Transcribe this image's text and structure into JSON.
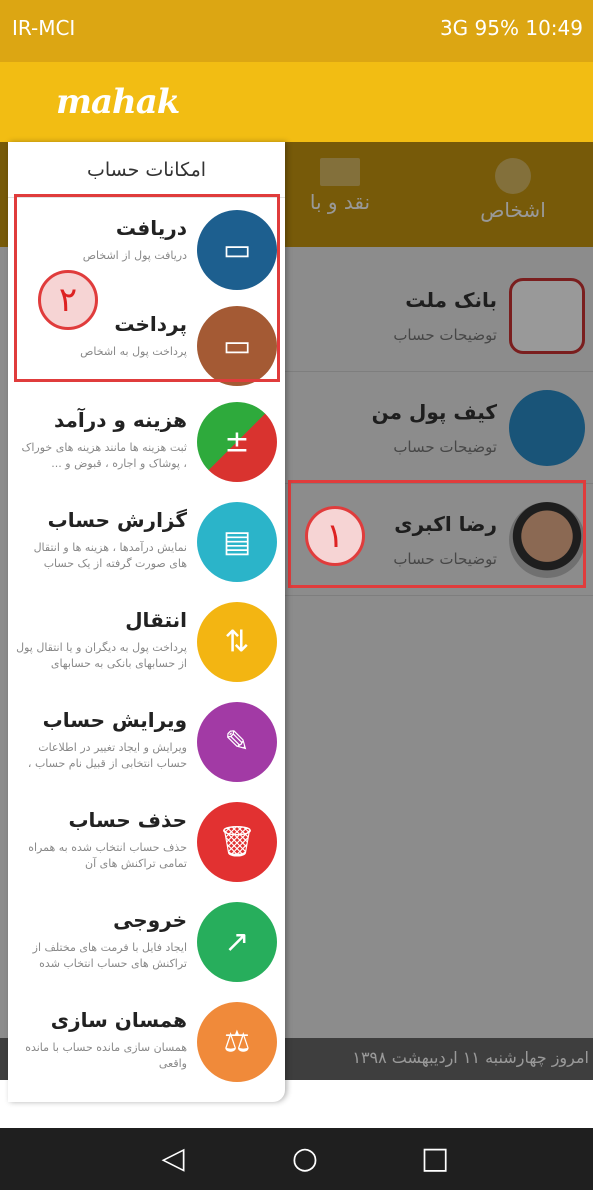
{
  "status": {
    "carrier": "IR-MCI",
    "battery": "95%",
    "time": "10:49",
    "signal": "3G"
  },
  "app": {
    "logo": "mahak"
  },
  "tabs": [
    {
      "label": "اشخاص",
      "icon": "people-icon"
    },
    {
      "label": "نقد و با",
      "icon": "cash-icon"
    }
  ],
  "accounts": [
    {
      "name": "بانک ملت",
      "desc": "توضیحات حساب",
      "icon": "bank-mellat-icon"
    },
    {
      "name": "کیف پول من",
      "desc": "توضیحات حساب",
      "icon": "wallet-icon"
    },
    {
      "name": "رضا اکبری",
      "desc": "توضیحات حساب",
      "icon": "user-avatar"
    }
  ],
  "date_text": "امروز چهارشنبه ۱۱ اردیبهشت ۱۳۹۸",
  "drawer": {
    "title": "امکانات حساب",
    "items": [
      {
        "title": "دریافت",
        "sub": "دریافت پول از اشخاص",
        "color": "#1d5f8f",
        "icon": "wallet-receive-icon"
      },
      {
        "title": "پرداخت",
        "sub": "پرداخت پول به اشخاص",
        "color": "#a45a34",
        "icon": "wallet-pay-icon"
      },
      {
        "title": "هزینه و درآمد",
        "sub": "ثبت هزینه ها مانند هزینه های خوراک ، پوشاک و اجاره ، قبوض و ...",
        "color": "#d9332f",
        "icon": "income-expense-icon"
      },
      {
        "title": "گزارش حساب",
        "sub": "نمایش درآمدها ، هزینه ها و انتقال های صورت گرفته از یک حساب",
        "color": "#2bb4c9",
        "icon": "report-icon"
      },
      {
        "title": "انتقال",
        "sub": "پرداخت پول به دیگران و یا انتقال پول از حسابهای بانکی به حسابهای",
        "color": "#f3b512",
        "icon": "transfer-icon"
      },
      {
        "title": "ویرایش حساب",
        "sub": "ویرایش و ایجاد تغییر در اطلاعات حساب انتخابی از قبیل نام حساب ،",
        "color": "#a23aa5",
        "icon": "edit-icon"
      },
      {
        "title": "حذف حساب",
        "sub": "حذف حساب انتخاب شده به همراه تمامی تراکنش های آن",
        "color": "#e23131",
        "icon": "trash-icon"
      },
      {
        "title": "خروجی",
        "sub": "ایجاد فایل با فرمت های مختلف از تراکنش های حساب انتخاب شده",
        "color": "#27ae5c",
        "icon": "export-icon"
      },
      {
        "title": "همسان سازی",
        "sub": "همسان سازی مانده حساب با مانده واقعی",
        "color": "#f08a3a",
        "icon": "balance-icon"
      }
    ]
  },
  "annotations": [
    "۲",
    "۱"
  ]
}
